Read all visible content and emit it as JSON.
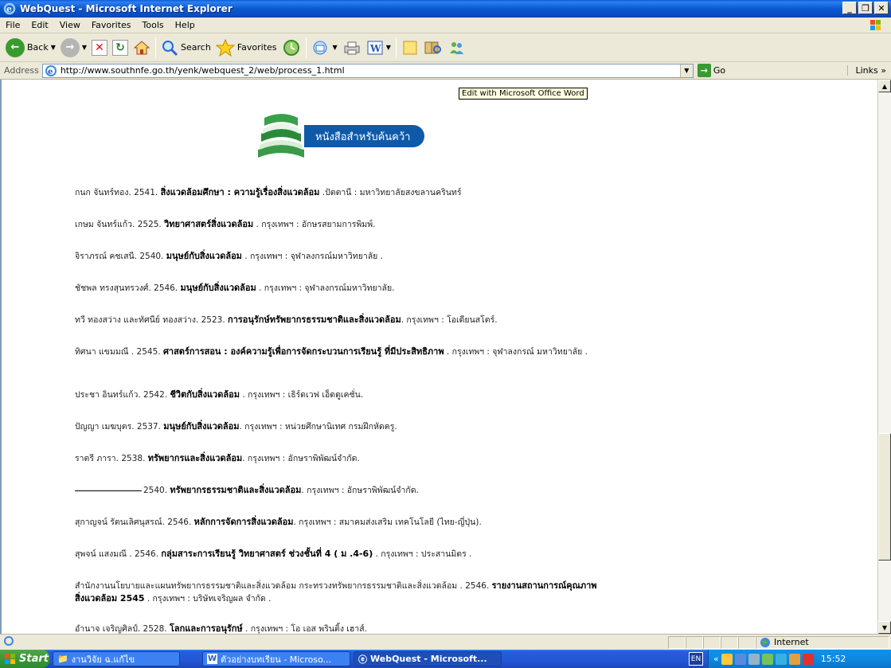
{
  "window": {
    "title": "WebQuest - Microsoft Internet Explorer"
  },
  "menu": [
    "File",
    "Edit",
    "View",
    "Favorites",
    "Tools",
    "Help"
  ],
  "toolbar": {
    "back": "Back",
    "search": "Search",
    "favorites": "Favorites"
  },
  "address": {
    "label": "Address",
    "url": "http://www.southnfe.go.th/yenk/webquest_2/web/process_1.html",
    "go": "Go",
    "links": "Links"
  },
  "tooltip": "Edit with Microsoft Office Word",
  "banner": {
    "label": "หนังสือสำหรับค้นคว้า"
  },
  "references": [
    {
      "pre": "กนก จันทร์ทอง. 2541. ",
      "title": "สิ่งแวดล้อมศึกษา : ความรู้เรื่องสิ่งแวดล้อม",
      "post": " .ปัตตานี : มหาวิทยาลัยสงขลานครินทร์"
    },
    {
      "pre": "เกษม จันทร์แก้ว. 2525. ",
      "title": "วิทยาศาสตร์สิ่งแวดล้อม",
      "post": " . กรุงเทพฯ : อักษรสยามการพิมพ์."
    },
    {
      "pre": "จิราภรณ์ คชเสนี. 2540. ",
      "title": "มนุษย์กับสิ่งแวดล้อม",
      "post": " . กรุงเทพฯ : จุฬาลงกรณ์มหาวิทยาลัย ."
    },
    {
      "pre": "ชัชพล ทรงสุนทรวงศ์. 2546. ",
      "title": "มนุษย์กับสิ่งแวดล้อม",
      "post": " . กรุงเทพฯ : จุฬาลงกรณ์มหาวิทยาลัย."
    },
    {
      "pre": "ทวี ทองสว่าง และทัศนีย์ ทองสว่าง. 2523. ",
      "title": "การอนุรักษ์ทรัพยากรธรรมชาติและสิ่งแวดล้อม",
      "post": ". กรุงเทพฯ : โอเดียนสโตร์."
    },
    {
      "pre": "ทิศนา แขมมณี . 2545. ",
      "title": "ศาสตร์การสอน : องค์ความรู้เพื่อการจัดกระบวนการเรียนรู้ ที่มีประสิทธิภาพ",
      "post": " . กรุงเทพฯ : จุฬาลงกรณ์ มหาวิทยาลัย ."
    },
    {
      "pre": "ประชา อินทร์แก้ว. 2542. ",
      "title": "ชีวิตกับสิ่งแวดล้อม",
      "post": " . กรุงเทพฯ : เธิร์ดเวฟ เอ็ดดูเคชั่น."
    },
    {
      "pre": "ปัญญา เมฆบุตร. 2537. ",
      "title": "มนุษย์กับสิ่งแวดล้อม",
      "post": ". กรุงเทพฯ : หน่วยศึกษานิเทศ กรมฝึกหัดครู."
    },
    {
      "pre": "ราตรี ภารา. 2538. ",
      "title": "ทรัพยากรและสิ่งแวดล้อม",
      "post": ". กรุงเทพฯ : อักษราพิพัฒน์จำกัด."
    },
    {
      "pre": "2540. ",
      "title": "ทรัพยากรธรรมชาติและสิ่งแวดล้อม",
      "post": ". กรุงเทพฯ : อักษราพิพัฒน์จำกัด."
    },
    {
      "pre": "สุกาญจน์ รัตนเลิศนุสรณ์. 2546. ",
      "title": "หลักการจัดการสิ่งแวดล้อม",
      "post": ". กรุงเทพฯ : สมาคมส่งเสริม เทคโนโลยี (ไทย-ญี่ปุ่น)."
    },
    {
      "pre": "สุพจน์ แสงมณี . 2546. ",
      "title": "กลุ่มสาระการเรียนรู้ วิทยาศาสตร์ ช่วงชั้นที่ 4 ( ม .4-6)",
      "post": " . กรุงเทพฯ : ประสานมิตร ."
    },
    {
      "pre": "สำนักงานนโยบายและแผนทรัพยากรธรรมชาติและสิ่งแวดล้อม กระทรวงทรัพยากรธรรมชาติและสิ่งแวดล้อม . 2546. ",
      "title": "รายงานสถานการณ์คุณภาพสิ่งแวดล้อม 2545",
      "post": " . กรุงเทพฯ : บริษัทเจริญผล จำกัด ."
    },
    {
      "pre": "อำนาจ เจริญศิลป์. 2528. ",
      "title": "โลกและการอนุรักษ์",
      "post": " . กรุงเทพฯ : โอ เอส พรินติ้ง เฮาส์."
    }
  ],
  "status": {
    "zone": "Internet"
  },
  "taskbar": {
    "start": "Start",
    "tasks": [
      "งานวิจัย ฉ.แก้ไข",
      "ตัวอย่างบทเรียน - Microso...",
      "WebQuest - Microsoft..."
    ],
    "lang": "EN",
    "clock": "15:52"
  }
}
